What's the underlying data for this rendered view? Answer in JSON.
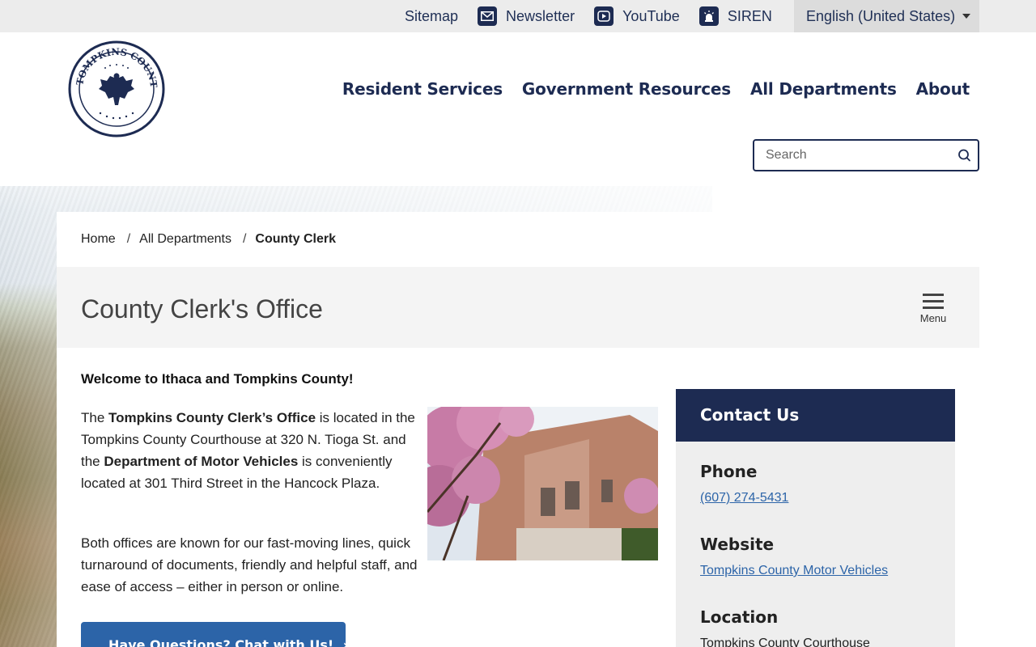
{
  "utility": {
    "links": [
      {
        "label": "Sitemap",
        "icon": "none"
      },
      {
        "label": "Newsletter",
        "icon": "envelope-icon"
      },
      {
        "label": "YouTube",
        "icon": "youtube-play-icon"
      },
      {
        "label": "SIREN",
        "icon": "siren-alarm-icon"
      }
    ],
    "language": "English (United States)"
  },
  "header": {
    "logo_alt": "TOMPKINS COUNTY",
    "nav": [
      "Resident Services",
      "Government Resources",
      "All Departments",
      "About"
    ],
    "search_placeholder": "Search"
  },
  "breadcrumb": {
    "items": [
      "Home",
      "All Departments"
    ],
    "current": "County Clerk"
  },
  "page": {
    "title": "County Clerk's Office",
    "menu_label": "Menu",
    "welcome": "Welcome to Ithaca and Tompkins County!",
    "para1": {
      "t1": "The ",
      "b1": "Tompkins County Clerk’s Office",
      "t2": " is located in the Tompkins County Courthouse at 320 N. Tioga St. and the ",
      "b2": "Department of Motor Vehicles",
      "t3": " is conveniently located at 301 Third Street in the Hancock Plaza."
    },
    "para2": "Both offices are known for our fast-moving lines, quick turnaround of documents, friendly and helpful staff, and ease of access – either in person or online.",
    "chat_button": "Have Questions? Chat with Us!"
  },
  "contact": {
    "heading": "Contact Us",
    "phone_label": "Phone",
    "phone": "(607) 274-5431",
    "website_label": "Website",
    "website": "Tompkins County Motor Vehicles",
    "location_label": "Location",
    "location": "Tompkins County Courthouse"
  },
  "colors": {
    "navy": "#1d2b52",
    "link_blue": "#2c64a8",
    "title_bar": "#f4f4f4",
    "contact_bg": "#eeeeee"
  }
}
